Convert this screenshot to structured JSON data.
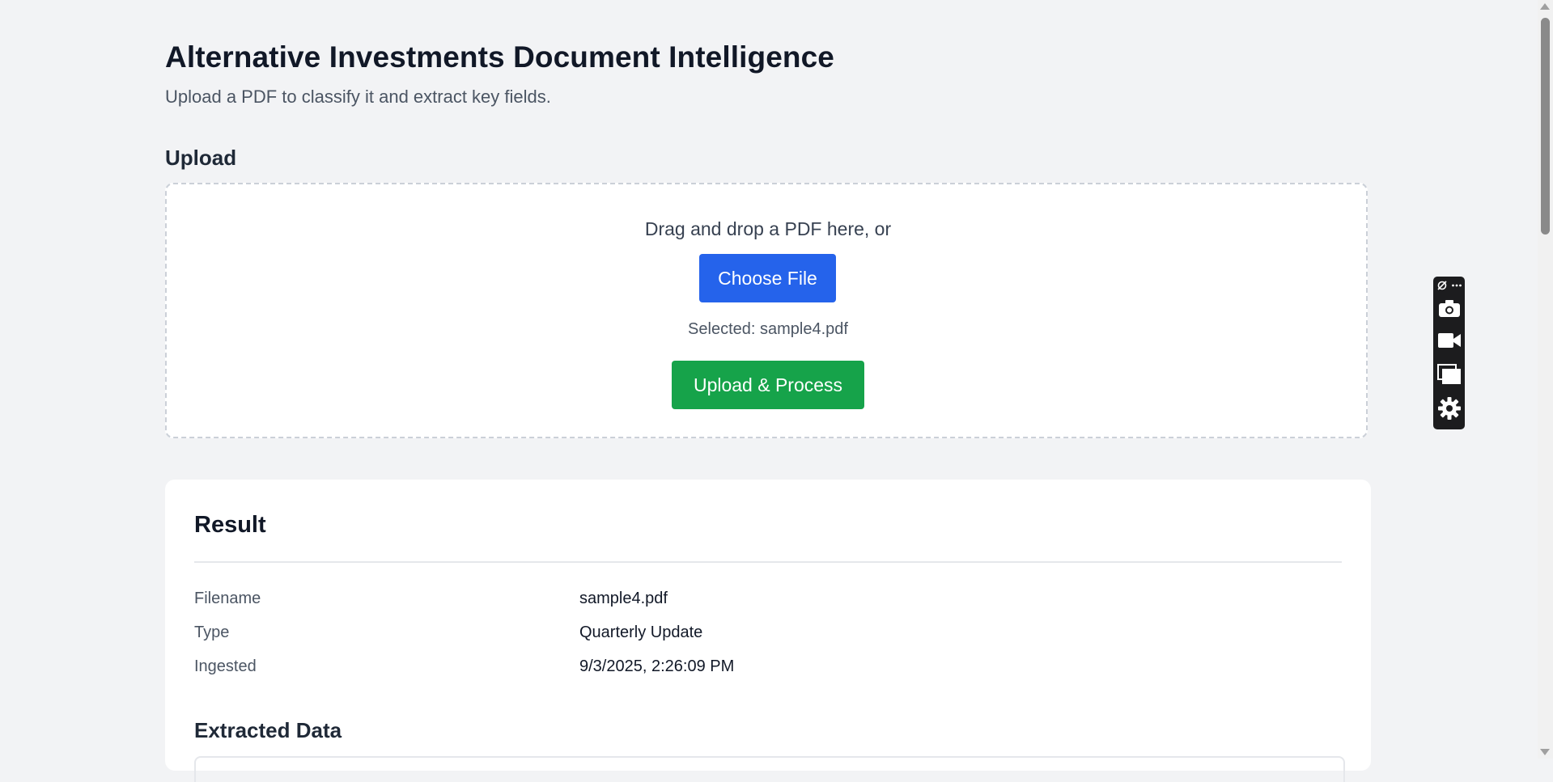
{
  "header": {
    "title": "Alternative Investments Document Intelligence",
    "subtitle": "Upload a PDF to classify it and extract key fields."
  },
  "upload": {
    "section_title": "Upload",
    "drop_text": "Drag and drop a PDF here, or",
    "choose_label": "Choose File",
    "selected_text": "Selected: sample4.pdf",
    "upload_label": "Upload & Process"
  },
  "result": {
    "title": "Result",
    "fields": [
      {
        "label": "Filename",
        "value": "sample4.pdf"
      },
      {
        "label": "Type",
        "value": "Quarterly Update"
      },
      {
        "label": "Ingested",
        "value": "9/3/2025, 2:26:09 PM"
      }
    ],
    "extracted_title": "Extracted Data"
  },
  "toolbar": {
    "icons": [
      "link-icon",
      "more-icon",
      "camera-icon",
      "video-icon",
      "window-icon",
      "gear-icon"
    ]
  },
  "colors": {
    "primary": "#2563eb",
    "success": "#16a34a",
    "background": "#f2f3f5"
  }
}
